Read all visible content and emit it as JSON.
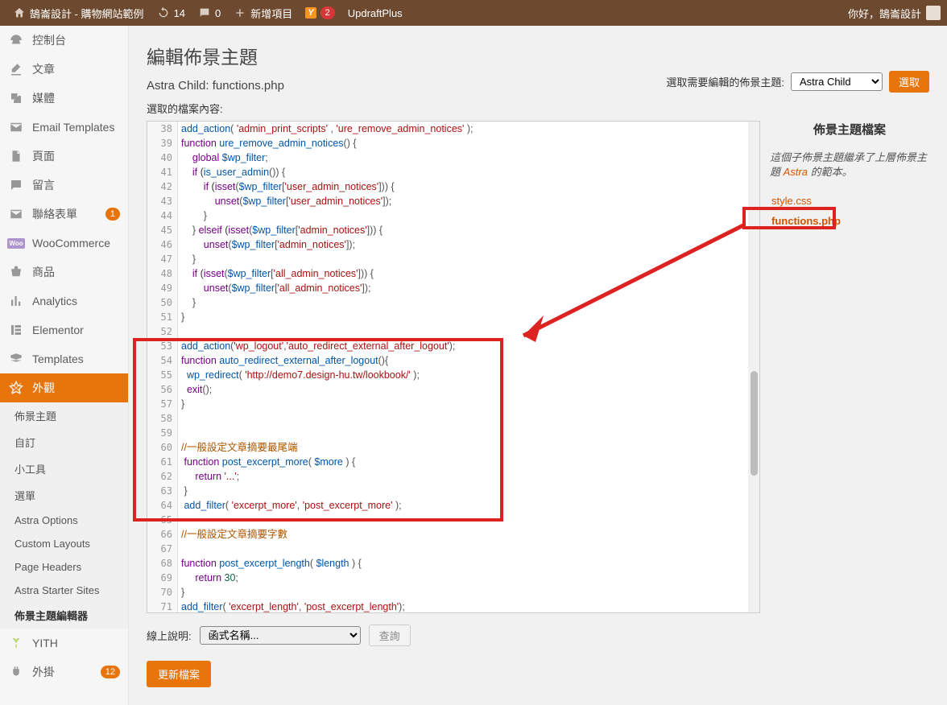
{
  "adminbar": {
    "site": "鵠崙設計 - 購物網站範例",
    "updates": "14",
    "comments": "0",
    "new": "新增項目",
    "yoast": "2",
    "updraft": "UpdraftPlus",
    "greeting": "你好，鵠崙設計"
  },
  "sidebar": {
    "items": [
      {
        "label": "控制台"
      },
      {
        "label": "文章"
      },
      {
        "label": "媒體"
      },
      {
        "label": "Email Templates"
      },
      {
        "label": "頁面"
      },
      {
        "label": "留言"
      },
      {
        "label": "聯絡表單",
        "badge": "1"
      },
      {
        "label": "WooCommerce"
      },
      {
        "label": "商品"
      },
      {
        "label": "Analytics"
      },
      {
        "label": "Elementor"
      },
      {
        "label": "Templates"
      },
      {
        "label": "外觀"
      },
      {
        "label": "YITH"
      },
      {
        "label": "外掛",
        "badge": "12"
      }
    ],
    "submenu": [
      "佈景主題",
      "自訂",
      "小工具",
      "選單",
      "Astra Options",
      "Custom Layouts",
      "Page Headers",
      "Astra Starter Sites",
      "佈景主題編輯器"
    ]
  },
  "page": {
    "title": "編輯佈景主題",
    "subtitle": "Astra Child: functions.php",
    "file_label": "選取的檔案內容:",
    "select_label": "選取需要編輯的佈景主題:",
    "select_value": "Astra Child",
    "select_btn": "選取",
    "help_label": "線上說明:",
    "help_placeholder": "函式名稱...",
    "help_btn": "查詢",
    "update_btn": "更新檔案"
  },
  "files": {
    "title": "佈景主題檔案",
    "desc_pre": "這個子佈景主題繼承了上層佈景主題 ",
    "desc_link": "Astra",
    "desc_post": " 的範本。",
    "list": [
      "style.css",
      "functions.php"
    ]
  },
  "code": {
    "start": 38,
    "lines": [
      [
        [
          "fn",
          "add_action"
        ],
        [
          "punc",
          "( "
        ],
        [
          "str",
          "'admin_print_scripts'"
        ],
        [
          "punc",
          " , "
        ],
        [
          "str",
          "'ure_remove_admin_notices'"
        ],
        [
          "punc",
          " );"
        ]
      ],
      [
        [
          "kw",
          "function"
        ],
        [
          "plain",
          " "
        ],
        [
          "fn",
          "ure_remove_admin_notices"
        ],
        [
          "punc",
          "() {"
        ]
      ],
      [
        [
          "plain",
          "    "
        ],
        [
          "kw",
          "global"
        ],
        [
          "plain",
          " "
        ],
        [
          "var",
          "$wp_filter"
        ],
        [
          "punc",
          ";"
        ]
      ],
      [
        [
          "plain",
          "    "
        ],
        [
          "kw",
          "if"
        ],
        [
          "plain",
          " ("
        ],
        [
          "fn",
          "is_user_admin"
        ],
        [
          "punc",
          "()) {"
        ]
      ],
      [
        [
          "plain",
          "        "
        ],
        [
          "kw",
          "if"
        ],
        [
          "plain",
          " ("
        ],
        [
          "kw",
          "isset"
        ],
        [
          "punc",
          "("
        ],
        [
          "var",
          "$wp_filter"
        ],
        [
          "punc",
          "["
        ],
        [
          "str",
          "'user_admin_notices'"
        ],
        [
          "punc",
          "])) {"
        ]
      ],
      [
        [
          "plain",
          "            "
        ],
        [
          "kw",
          "unset"
        ],
        [
          "punc",
          "("
        ],
        [
          "var",
          "$wp_filter"
        ],
        [
          "punc",
          "["
        ],
        [
          "str",
          "'user_admin_notices'"
        ],
        [
          "punc",
          "]);"
        ]
      ],
      [
        [
          "plain",
          "        "
        ],
        [
          "punc",
          "}"
        ]
      ],
      [
        [
          "plain",
          "    "
        ],
        [
          "punc",
          "} "
        ],
        [
          "kw",
          "elseif"
        ],
        [
          "plain",
          " ("
        ],
        [
          "kw",
          "isset"
        ],
        [
          "punc",
          "("
        ],
        [
          "var",
          "$wp_filter"
        ],
        [
          "punc",
          "["
        ],
        [
          "str",
          "'admin_notices'"
        ],
        [
          "punc",
          "])) {"
        ]
      ],
      [
        [
          "plain",
          "        "
        ],
        [
          "kw",
          "unset"
        ],
        [
          "punc",
          "("
        ],
        [
          "var",
          "$wp_filter"
        ],
        [
          "punc",
          "["
        ],
        [
          "str",
          "'admin_notices'"
        ],
        [
          "punc",
          "]);"
        ]
      ],
      [
        [
          "plain",
          "    "
        ],
        [
          "punc",
          "}"
        ]
      ],
      [
        [
          "plain",
          "    "
        ],
        [
          "kw",
          "if"
        ],
        [
          "plain",
          " ("
        ],
        [
          "kw",
          "isset"
        ],
        [
          "punc",
          "("
        ],
        [
          "var",
          "$wp_filter"
        ],
        [
          "punc",
          "["
        ],
        [
          "str",
          "'all_admin_notices'"
        ],
        [
          "punc",
          "])) {"
        ]
      ],
      [
        [
          "plain",
          "        "
        ],
        [
          "kw",
          "unset"
        ],
        [
          "punc",
          "("
        ],
        [
          "var",
          "$wp_filter"
        ],
        [
          "punc",
          "["
        ],
        [
          "str",
          "'all_admin_notices'"
        ],
        [
          "punc",
          "]);"
        ]
      ],
      [
        [
          "plain",
          "    "
        ],
        [
          "punc",
          "}"
        ]
      ],
      [
        [
          "punc",
          "}"
        ]
      ],
      [],
      [
        [
          "fn",
          "add_action"
        ],
        [
          "punc",
          "("
        ],
        [
          "str",
          "'wp_logout'"
        ],
        [
          "punc",
          ","
        ],
        [
          "str",
          "'auto_redirect_external_after_logout'"
        ],
        [
          "punc",
          ");"
        ]
      ],
      [
        [
          "kw",
          "function"
        ],
        [
          "plain",
          " "
        ],
        [
          "fn",
          "auto_redirect_external_after_logout"
        ],
        [
          "punc",
          "(){"
        ]
      ],
      [
        [
          "plain",
          "  "
        ],
        [
          "fn",
          "wp_redirect"
        ],
        [
          "punc",
          "( "
        ],
        [
          "str",
          "'http://demo7.design-hu.tw/lookbook/'"
        ],
        [
          "punc",
          " );"
        ]
      ],
      [
        [
          "plain",
          "  "
        ],
        [
          "kw",
          "exit"
        ],
        [
          "punc",
          "();"
        ]
      ],
      [
        [
          "punc",
          "}"
        ]
      ],
      [],
      [],
      [
        [
          "com",
          "//一般設定文章摘要最尾端"
        ]
      ],
      [
        [
          "plain",
          " "
        ],
        [
          "kw",
          "function"
        ],
        [
          "plain",
          " "
        ],
        [
          "fn",
          "post_excerpt_more"
        ],
        [
          "punc",
          "( "
        ],
        [
          "var",
          "$more"
        ],
        [
          "punc",
          " ) {"
        ]
      ],
      [
        [
          "plain",
          "     "
        ],
        [
          "kw",
          "return"
        ],
        [
          "plain",
          " "
        ],
        [
          "str",
          "'...'"
        ],
        [
          "punc",
          ";"
        ]
      ],
      [
        [
          "plain",
          " "
        ],
        [
          "punc",
          "}"
        ]
      ],
      [
        [
          "plain",
          " "
        ],
        [
          "fn",
          "add_filter"
        ],
        [
          "punc",
          "( "
        ],
        [
          "str",
          "'excerpt_more'"
        ],
        [
          "punc",
          ", "
        ],
        [
          "str",
          "'post_excerpt_more'"
        ],
        [
          "punc",
          " );"
        ]
      ],
      [],
      [
        [
          "com",
          "//一般設定文章摘要字數"
        ]
      ],
      [],
      [
        [
          "kw",
          "function"
        ],
        [
          "plain",
          " "
        ],
        [
          "fn",
          "post_excerpt_length"
        ],
        [
          "punc",
          "( "
        ],
        [
          "var",
          "$length"
        ],
        [
          "punc",
          " ) {"
        ]
      ],
      [
        [
          "plain",
          "     "
        ],
        [
          "kw",
          "return"
        ],
        [
          "plain",
          " "
        ],
        [
          "num",
          "30"
        ],
        [
          "punc",
          ";"
        ]
      ],
      [
        [
          "punc",
          "}"
        ]
      ],
      [
        [
          "fn",
          "add_filter"
        ],
        [
          "punc",
          "( "
        ],
        [
          "str",
          "'excerpt_length'"
        ],
        [
          "punc",
          ", "
        ],
        [
          "str",
          "'post_excerpt_length'"
        ],
        [
          "punc",
          ");"
        ]
      ]
    ]
  }
}
